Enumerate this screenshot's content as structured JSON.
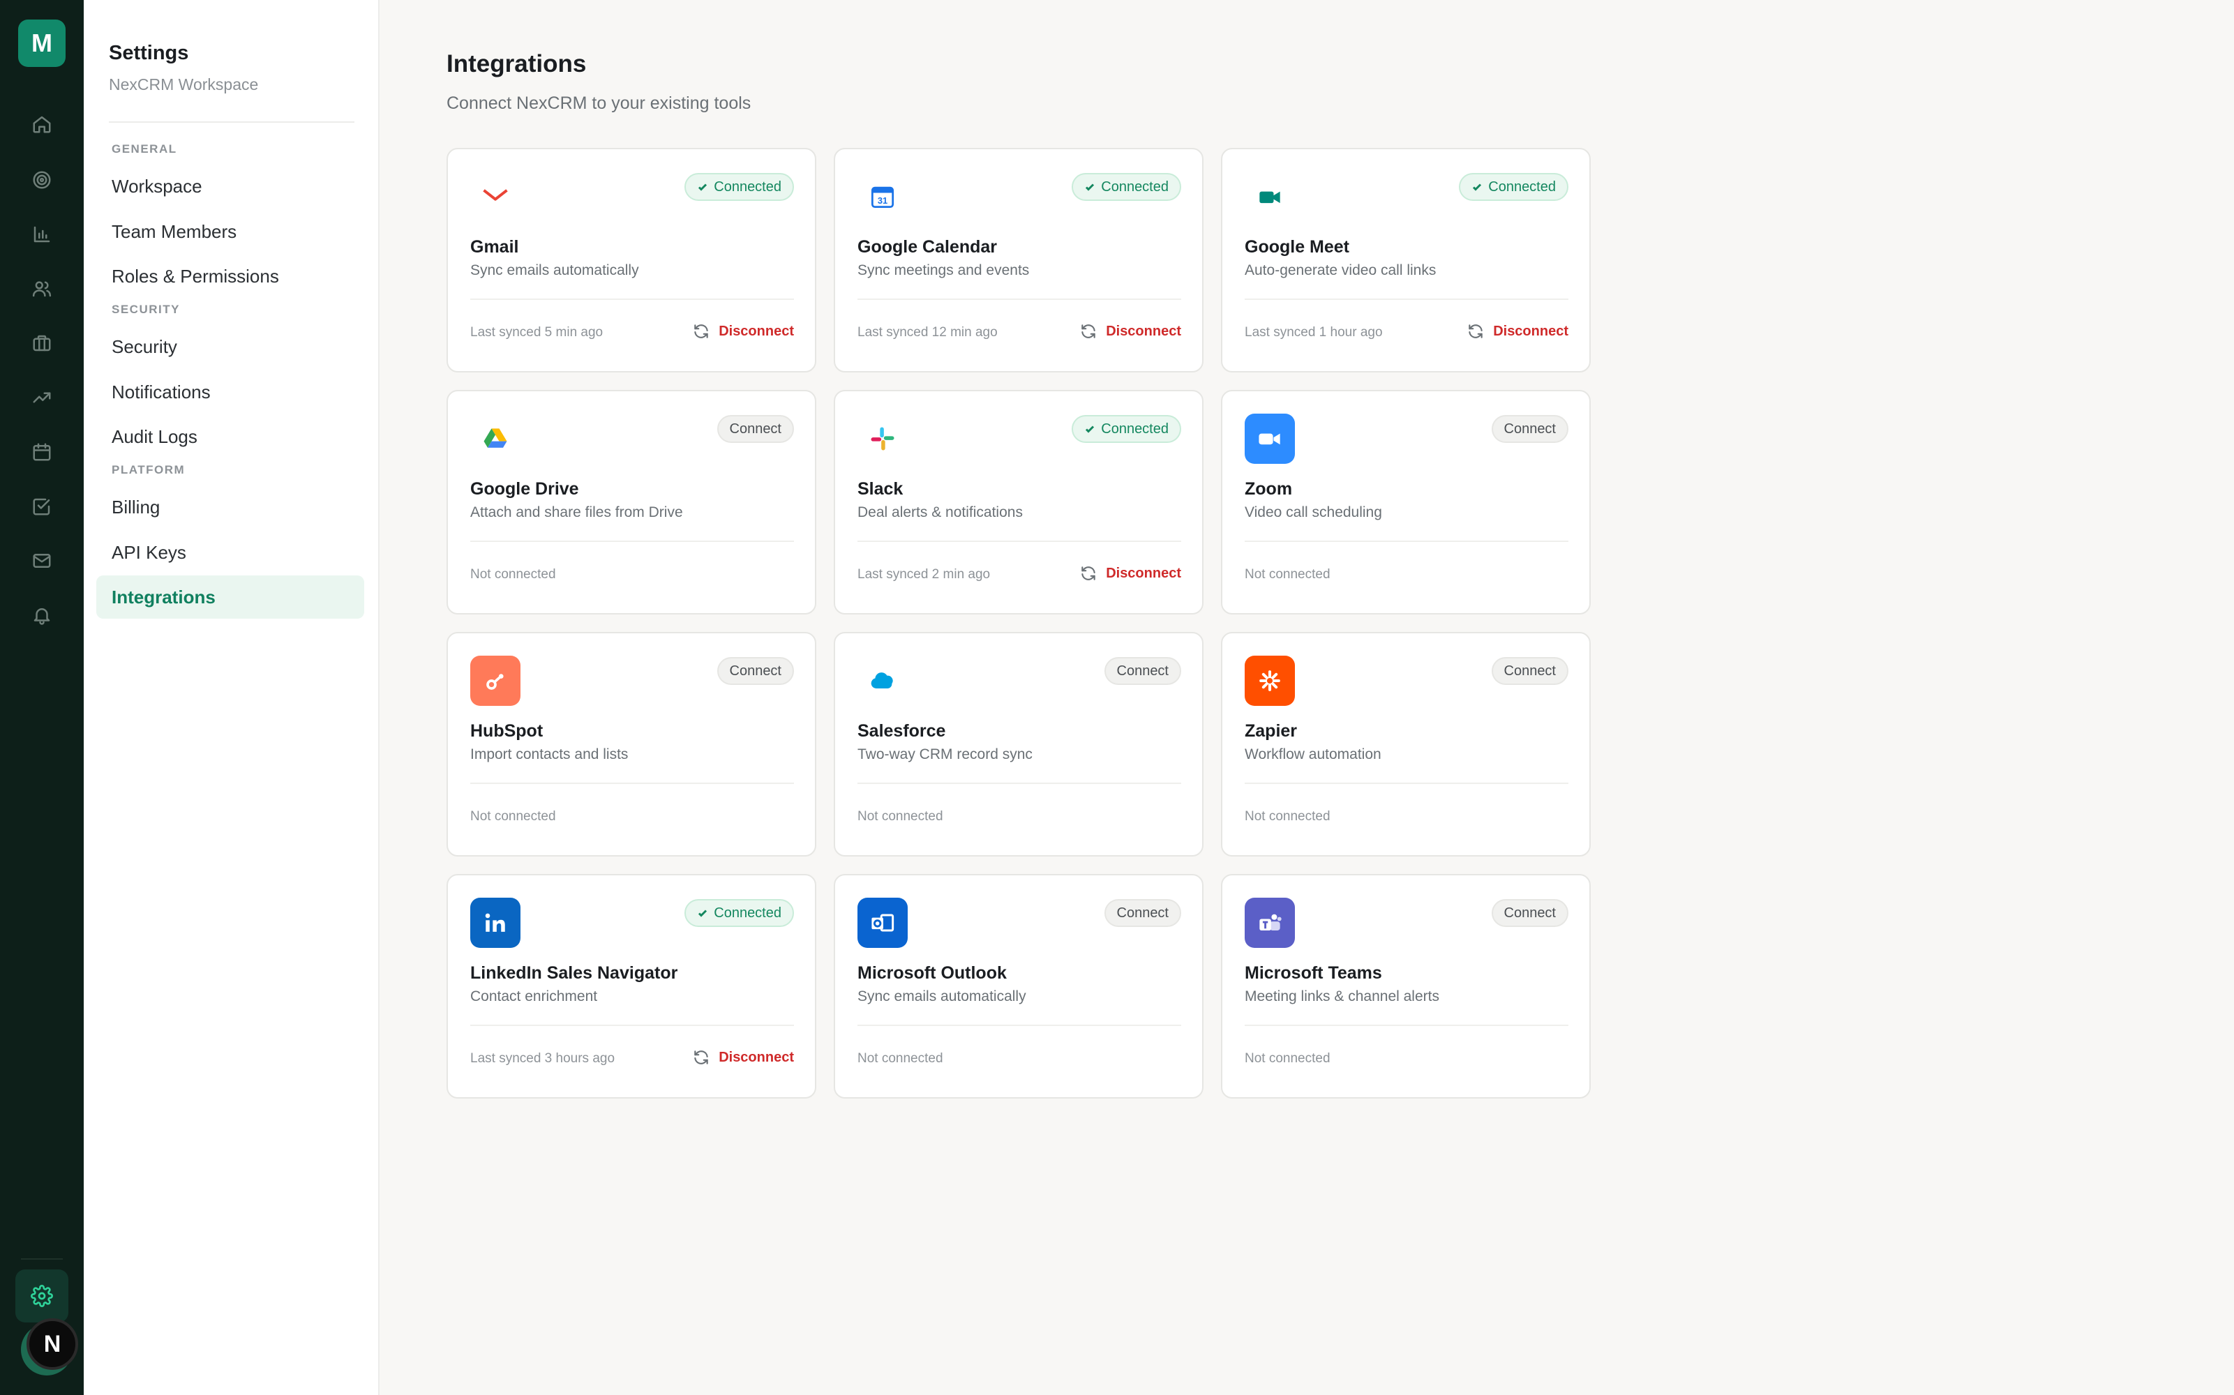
{
  "rail": {
    "logo": "M",
    "avatar": "N",
    "icons": [
      "home-icon",
      "target-icon",
      "bar-chart-icon",
      "users-icon",
      "briefcase-icon",
      "trending-icon",
      "calendar-icon",
      "task-icon",
      "mail-icon",
      "bell-icon"
    ]
  },
  "nav": {
    "title": "Settings",
    "subtitle": "NexCRM Workspace",
    "sections": {
      "general": "GENERAL",
      "security": "SECURITY",
      "platform": "PLATFORM"
    },
    "items": {
      "workspace": "Workspace",
      "team_members": "Team Members",
      "roles": "Roles & Permissions",
      "security": "Security",
      "notifications": "Notifications",
      "audit_logs": "Audit Logs",
      "billing": "Billing",
      "api_keys": "API Keys",
      "integrations": "Integrations"
    },
    "active": "Integrations"
  },
  "page": {
    "title": "Integrations",
    "subtitle": "Connect NexCRM to your existing tools"
  },
  "labels": {
    "connected": "Connected",
    "connect": "Connect",
    "disconnect": "Disconnect",
    "not_connected": "Not connected"
  },
  "integrations": [
    {
      "name": "Gmail",
      "desc": "Sync emails automatically",
      "connected": true,
      "status": "Last synced 5 min ago",
      "icon": "gmail-icon",
      "color": "#ea4335"
    },
    {
      "name": "Google Calendar",
      "desc": "Sync meetings and events",
      "connected": true,
      "status": "Last synced 12 min ago",
      "icon": "google-calendar-icon",
      "color": "#1a73e8"
    },
    {
      "name": "Google Meet",
      "desc": "Auto-generate video call links",
      "connected": true,
      "status": "Last synced 1 hour ago",
      "icon": "google-meet-icon",
      "color": "#00897b"
    },
    {
      "name": "Google Drive",
      "desc": "Attach and share files from Drive",
      "connected": false,
      "status": "Not connected",
      "icon": "google-drive-icon",
      "color": "#34a853"
    },
    {
      "name": "Slack",
      "desc": "Deal alerts & notifications",
      "connected": true,
      "status": "Last synced 2 min ago",
      "icon": "slack-icon",
      "color": "#e01e5a"
    },
    {
      "name": "Zoom",
      "desc": "Video call scheduling",
      "connected": false,
      "status": "Not connected",
      "icon": "zoom-icon",
      "color": "#2d8cff"
    },
    {
      "name": "HubSpot",
      "desc": "Import contacts and lists",
      "connected": false,
      "status": "Not connected",
      "icon": "hubspot-icon",
      "color": "#ff7a59"
    },
    {
      "name": "Salesforce",
      "desc": "Two-way CRM record sync",
      "connected": false,
      "status": "Not connected",
      "icon": "salesforce-icon",
      "color": "#00a1e0"
    },
    {
      "name": "Zapier",
      "desc": "Workflow automation",
      "connected": false,
      "status": "Not connected",
      "icon": "zapier-icon",
      "color": "#ff4f00"
    },
    {
      "name": "LinkedIn Sales Navigator",
      "desc": "Contact enrichment",
      "connected": true,
      "status": "Last synced 3 hours ago",
      "icon": "linkedin-icon",
      "color": "#0a66c2"
    },
    {
      "name": "Microsoft Outlook",
      "desc": "Sync emails automatically",
      "connected": false,
      "status": "Not connected",
      "icon": "outlook-icon",
      "color": "#0a64d0"
    },
    {
      "name": "Microsoft Teams",
      "desc": "Meeting links & channel alerts",
      "connected": false,
      "status": "Not connected",
      "icon": "teams-icon",
      "color": "#5b5fc7"
    }
  ]
}
